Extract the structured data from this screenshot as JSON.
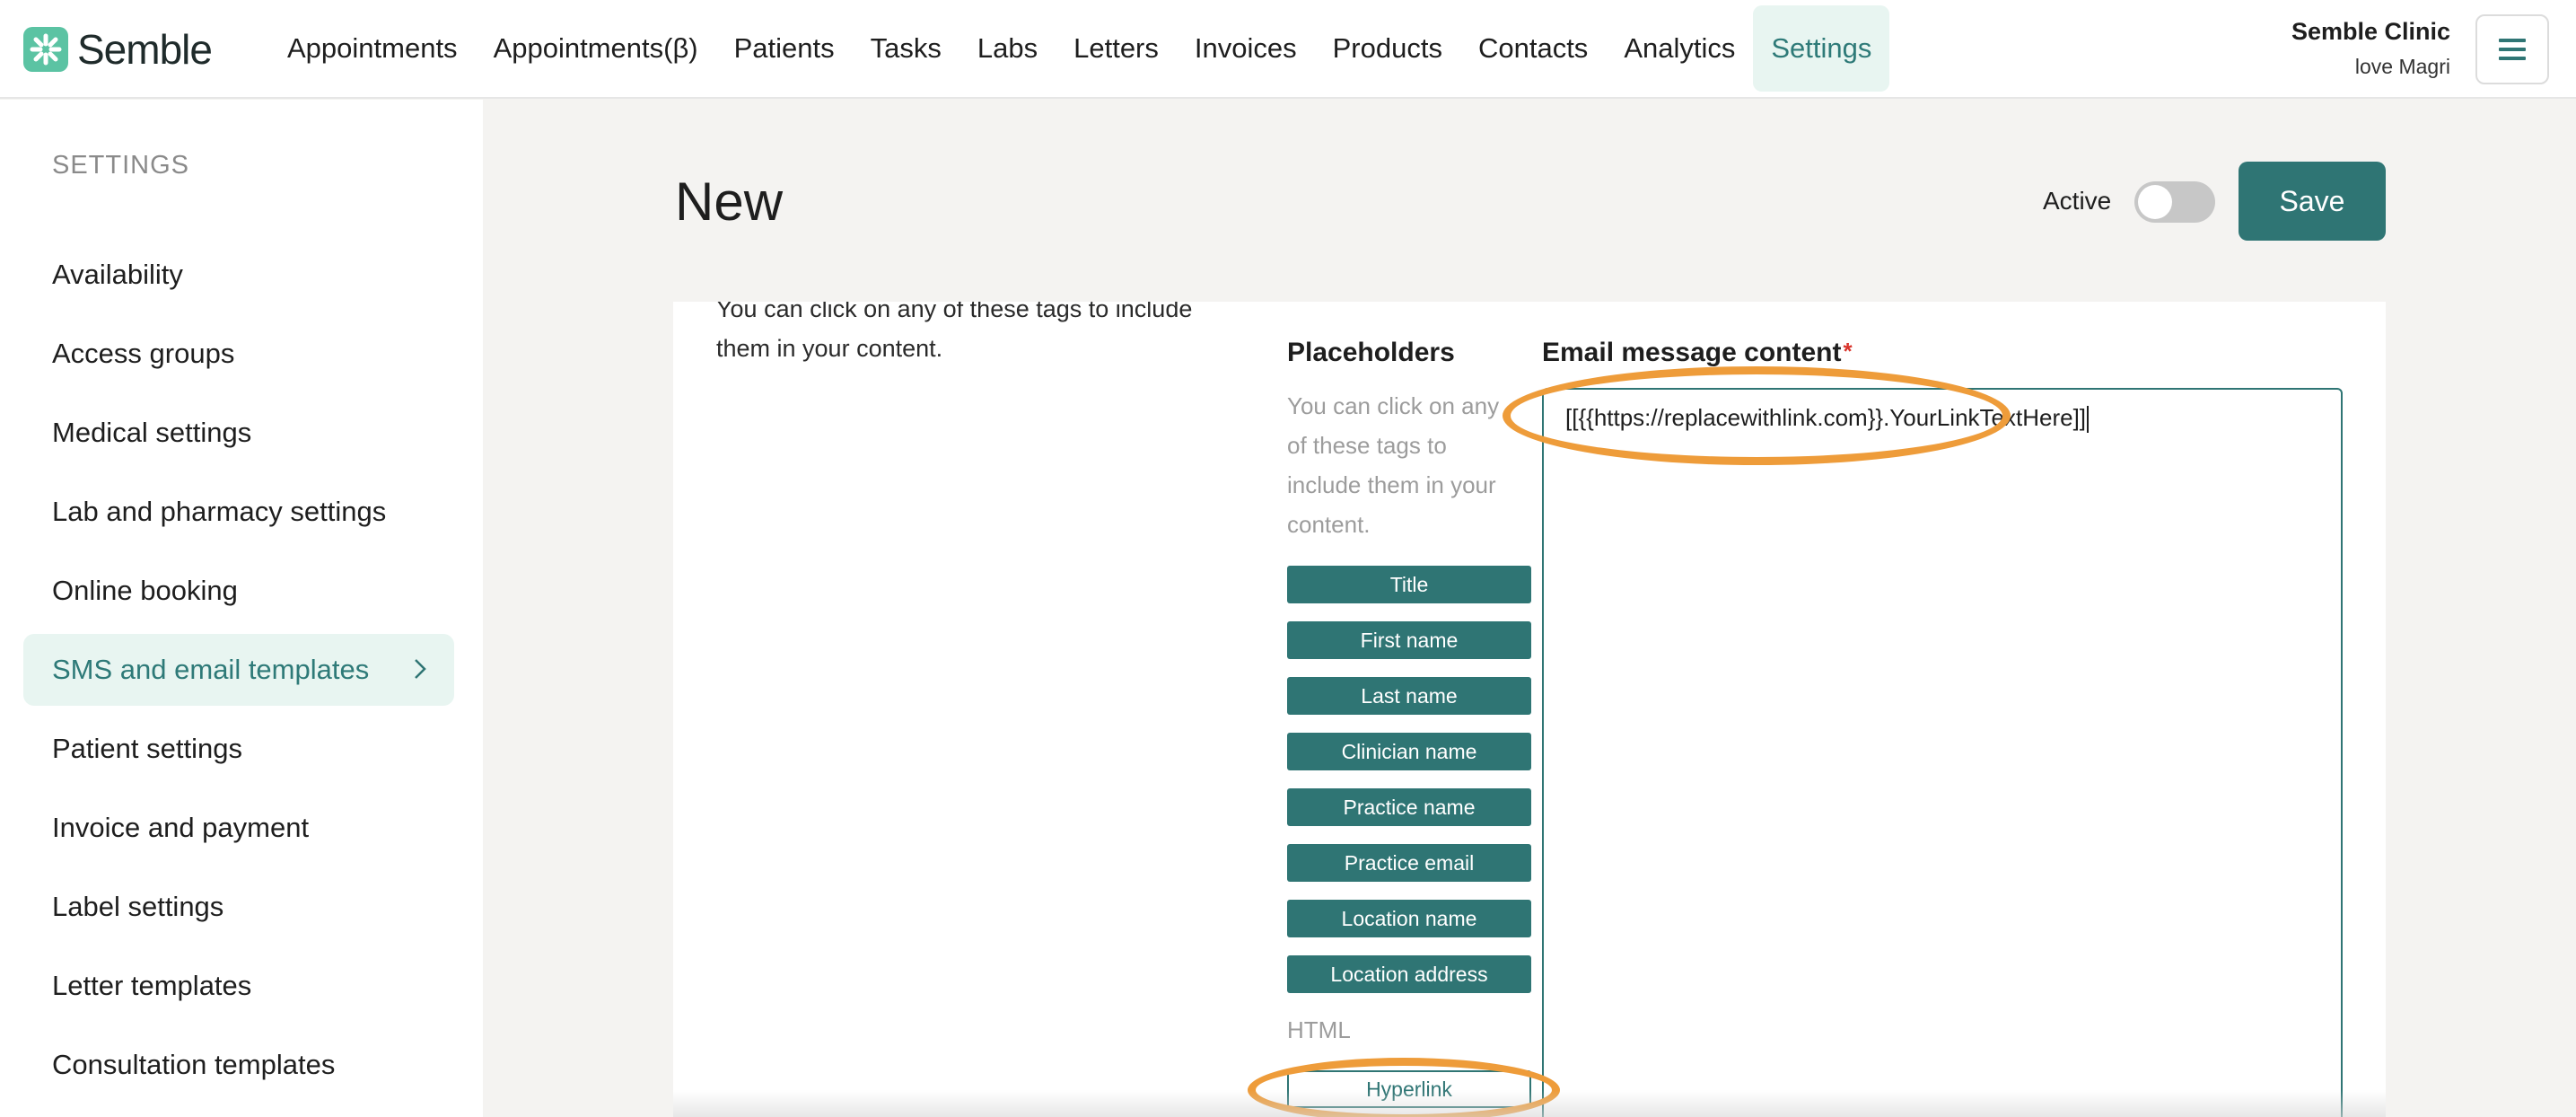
{
  "app": {
    "name": "Semble",
    "accent_color": "#2f7574",
    "highlight_color": "#ee9c3a"
  },
  "nav": {
    "items": [
      {
        "label": "Appointments",
        "active": false
      },
      {
        "label": "Appointments(β)",
        "active": false
      },
      {
        "label": "Patients",
        "active": false
      },
      {
        "label": "Tasks",
        "active": false
      },
      {
        "label": "Labs",
        "active": false
      },
      {
        "label": "Letters",
        "active": false
      },
      {
        "label": "Invoices",
        "active": false
      },
      {
        "label": "Products",
        "active": false
      },
      {
        "label": "Contacts",
        "active": false
      },
      {
        "label": "Analytics",
        "active": false
      },
      {
        "label": "Settings",
        "active": true
      }
    ],
    "clinic_name": "Semble Clinic",
    "user_name": "love Magri",
    "menu_icon": "hamburger-menu-icon"
  },
  "sidebar": {
    "heading": "SETTINGS",
    "items": [
      {
        "label": "Availability",
        "active": false
      },
      {
        "label": "Access groups",
        "active": false
      },
      {
        "label": "Medical settings",
        "active": false
      },
      {
        "label": "Lab and pharmacy settings",
        "active": false
      },
      {
        "label": "Online booking",
        "active": false
      },
      {
        "label": "SMS and email templates",
        "active": true
      },
      {
        "label": "Patient settings",
        "active": false
      },
      {
        "label": "Invoice and payment",
        "active": false
      },
      {
        "label": "Label settings",
        "active": false
      },
      {
        "label": "Letter templates",
        "active": false
      },
      {
        "label": "Consultation templates",
        "active": false
      }
    ]
  },
  "header": {
    "title": "New",
    "active_label": "Active",
    "active_enabled": false,
    "save_label": "Save"
  },
  "content": {
    "hint": "You can click on any of these tags to include them in your content.",
    "placeholders": {
      "title": "Placeholders",
      "description": "You can click on any of these tags to include them in your content.",
      "tags": [
        "Title",
        "First name",
        "Last name",
        "Clinician name",
        "Practice name",
        "Practice email",
        "Location name",
        "Location address"
      ],
      "html_label": "HTML",
      "html_tags": [
        "Hyperlink"
      ]
    },
    "email": {
      "label": "Email message content",
      "required_mark": "*",
      "value": "[[{{https://replacewithlink.com}}.YourLinkTextHere]]"
    }
  }
}
